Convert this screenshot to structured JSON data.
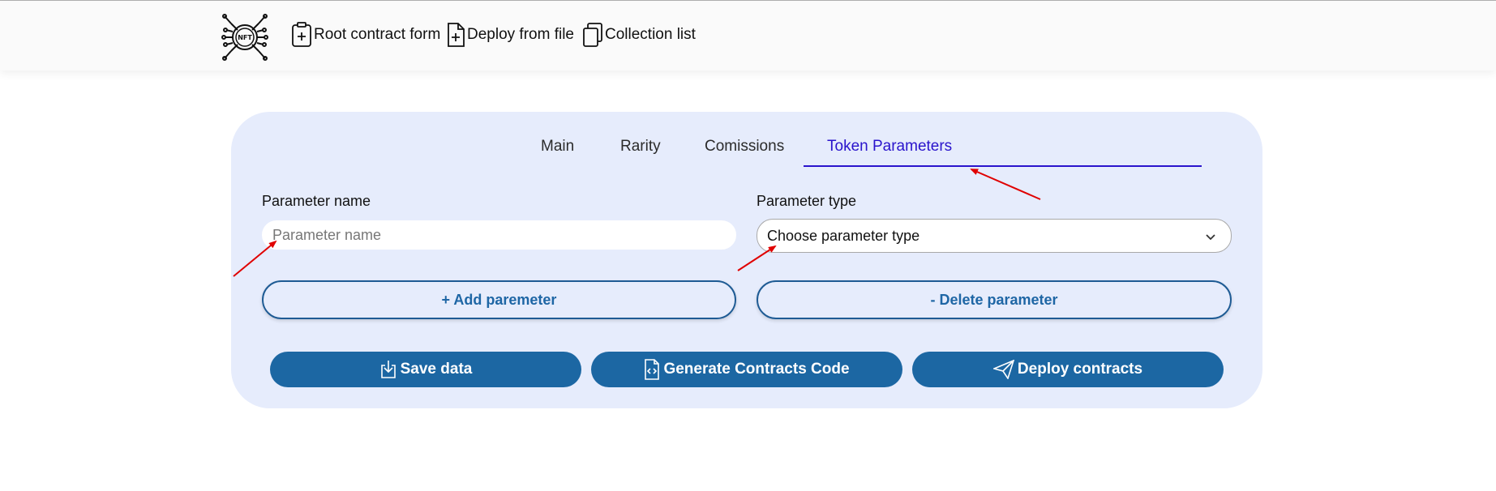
{
  "nav": {
    "logo_icon": "nft-circuit-logo-icon",
    "links": [
      {
        "label": "Root contract form",
        "icon": "clipboard-plus-icon"
      },
      {
        "label": "Deploy from file",
        "icon": "file-plus-icon"
      },
      {
        "label": "Collection list",
        "icon": "copy-files-icon"
      }
    ]
  },
  "tabs": [
    {
      "label": "Main",
      "active": false
    },
    {
      "label": "Rarity",
      "active": false
    },
    {
      "label": "Comissions",
      "active": false
    },
    {
      "label": "Token Parameters",
      "active": true
    }
  ],
  "form": {
    "param_name_label": "Parameter name",
    "param_name_placeholder": "Parameter name",
    "param_name_value": "",
    "param_type_label": "Parameter type",
    "param_type_selected": "Choose parameter type",
    "add_button": "+ Add paremeter",
    "delete_button": "- Delete parameter"
  },
  "actions": {
    "save": "Save data",
    "generate": "Generate Contracts Code",
    "deploy": "Deploy contracts"
  },
  "colors": {
    "accent": "#1c67a3",
    "active_tab": "#2a14cc",
    "card_bg": "#e6ecfc",
    "annotation_arrow": "#e00000"
  }
}
